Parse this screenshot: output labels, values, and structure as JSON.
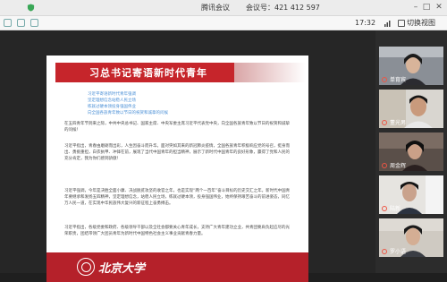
{
  "topbar": {
    "app_title": "腾讯会议",
    "meeting_label": "会议号：",
    "meeting_id": "421 412 597"
  },
  "subbar": {
    "time": "17:32",
    "switch_view_label": "切换视图"
  },
  "slide": {
    "banner_title": "习总书记寄语新时代青年",
    "links": [
      "习近平寄语新时代青年强调",
      "坚定理想信念站稳人民立场",
      "练就过硬本领投身强国伟业",
      "向全国各族青年致以节日的祝贺和诚挚的问候"
    ],
    "paragraphs": [
      "在五四青年节到来之际，中共中央总书记、国家主席、中央军委主席习近平代表党中央，向全国各族青年致以节日的祝贺和诚挚的问候！",
      "习近平指出，青春由磨砺而出彩，人生因奋斗而升华。面对突如其来的新冠肺炎疫情，全国各族青年积极响应党的号召，挺身而出、勇挑重担，白衣执甲、冲锋在前，展现了当代中国青年的担当精神，展示了新时代中国青年的良好形象，赢得了党和人民的充分肯定，我为你们感到骄傲！",
      "习近平强调，今年是决胜全面小康、决战脱贫攻坚的收官之年，也是实现“两个一百年”奋斗目标的历史交汇之年。新时代中国青年要继承和发扬五四精神，坚定理想信念，站稳人民立场，练就过硬本领，投身强国伟业，始终保持艰苦奋斗的前进姿态，同亿万人民一道，在实现中华民族伟大复兴的新征程上奋勇搏击。",
      "习近平指出，各级党委和政府、各级领导干部以及全社会都要关心青年成长，支持广大青年建功立业，共青团要肩负起应尽的光荣职责，团结带领广大团员青年为新时代中国特色社会主义事业贡献青春力量。"
    ],
    "footer_name": "北京大学"
  },
  "participants": [
    {
      "name": "单育宾"
    },
    {
      "name": "董光男"
    },
    {
      "name": "周金辉"
    },
    {
      "name": "陆新"
    },
    {
      "name": "罗小语"
    }
  ]
}
